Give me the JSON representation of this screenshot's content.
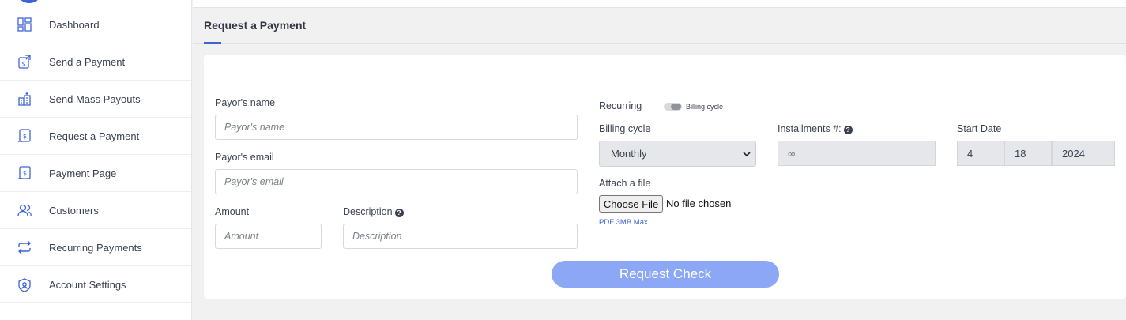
{
  "sidebar": {
    "items": [
      {
        "label": "Dashboard",
        "icon": "dashboard-icon"
      },
      {
        "label": "Send a Payment",
        "icon": "send-payment-icon"
      },
      {
        "label": "Send Mass Payouts",
        "icon": "mass-payouts-icon"
      },
      {
        "label": "Request a Payment",
        "icon": "request-payment-icon"
      },
      {
        "label": "Payment Page",
        "icon": "payment-page-icon"
      },
      {
        "label": "Customers",
        "icon": "customers-icon"
      },
      {
        "label": "Recurring Payments",
        "icon": "recurring-icon"
      },
      {
        "label": "Account Settings",
        "icon": "account-settings-icon"
      }
    ]
  },
  "tabs": {
    "active_label": "Request a Payment"
  },
  "form": {
    "payor_name": {
      "label": "Payor's name",
      "placeholder": "Payor's name",
      "value": ""
    },
    "payor_email": {
      "label": "Payor's email",
      "placeholder": "Payor's email",
      "value": ""
    },
    "amount": {
      "label": "Amount",
      "placeholder": "Amount",
      "value": ""
    },
    "description": {
      "label": "Description",
      "placeholder": "Description",
      "value": ""
    },
    "recurring": {
      "label": "Recurring",
      "toggle_text": "Billing cycle",
      "enabled": false
    },
    "billing_cycle": {
      "label": "Billing cycle",
      "value": "Monthly"
    },
    "installments": {
      "label": "Installments #:",
      "value": "∞"
    },
    "start_date": {
      "label": "Start Date",
      "month": "4",
      "day": "18",
      "year": "2024"
    },
    "attachment": {
      "label": "Attach a file",
      "button_label": "Choose File",
      "status": "No file chosen",
      "hint": "PDF 3MB Max"
    },
    "submit_label": "Request Check"
  },
  "colors": {
    "accent": "#3d63d8",
    "submit_bg": "#8ca7f5",
    "page_bg": "#f1f1f2"
  }
}
